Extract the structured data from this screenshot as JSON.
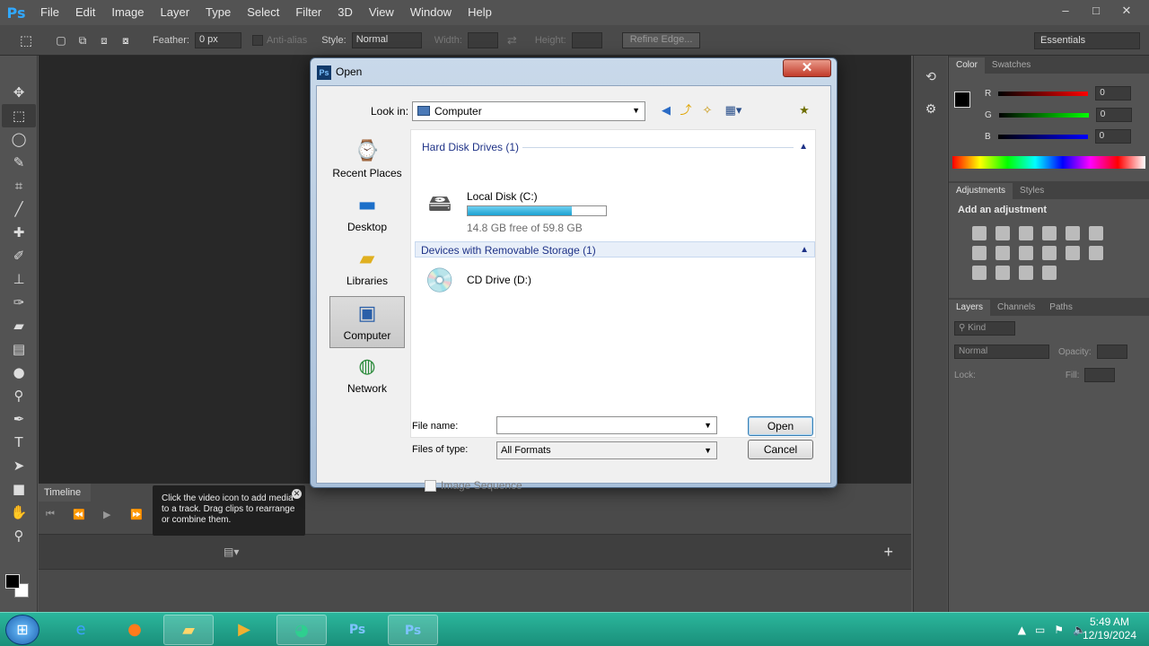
{
  "app": {
    "logo": "Ps",
    "menu": [
      "File",
      "Edit",
      "Image",
      "Layer",
      "Type",
      "Select",
      "Filter",
      "3D",
      "View",
      "Window",
      "Help"
    ],
    "window_controls": [
      "–",
      "□",
      "✕"
    ]
  },
  "options_bar": {
    "feather_label": "Feather:",
    "feather_value": "0 px",
    "antialias_label": "Anti-alias",
    "style_label": "Style:",
    "style_value": "Normal",
    "width_label": "Width:",
    "height_label": "Height:",
    "refine_edge": "Refine Edge...",
    "workspace": "Essentials"
  },
  "timeline": {
    "tab": "Timeline",
    "tooltip": "Click the video icon to add media to a track. Drag clips to rearrange or combine them."
  },
  "panels": {
    "color_tabs": [
      "Color",
      "Swatches"
    ],
    "rgb": [
      {
        "label": "R",
        "value": "0",
        "color": "#d01f1f"
      },
      {
        "label": "G",
        "value": "0",
        "color": "#1faa2b"
      },
      {
        "label": "B",
        "value": "0",
        "color": "#1f2fd0"
      }
    ],
    "adjust_tabs": [
      "Adjustments",
      "Styles"
    ],
    "adjust_heading": "Add an adjustment",
    "layers_tabs": [
      "Layers",
      "Channels",
      "Paths"
    ],
    "kind_label": "Kind",
    "blend_mode": "Normal",
    "opacity_label": "Opacity:",
    "lock_label": "Lock:",
    "fill_label": "Fill:"
  },
  "dialog": {
    "title": "Open",
    "icon_text": "Ps",
    "look_in_label": "Look in:",
    "look_in_value": "Computer",
    "places": [
      "Recent Places",
      "Desktop",
      "Libraries",
      "Computer",
      "Network"
    ],
    "group_hdd": "Hard Disk Drives (1)",
    "disk_name": "Local Disk (C:)",
    "disk_free": "14.8 GB free of 59.8 GB",
    "disk_used_fraction": 0.75,
    "group_removable": "Devices with Removable Storage (1)",
    "cd_name": "CD Drive (D:)",
    "file_name_label": "File name:",
    "file_name_value": "",
    "files_type_label": "Files of type:",
    "files_type_value": "All Formats",
    "open_button": "Open",
    "cancel_button": "Cancel",
    "image_sequence": "Image Sequence"
  },
  "taskbar": {
    "time": "5:49 AM",
    "date": "12/19/2024"
  }
}
